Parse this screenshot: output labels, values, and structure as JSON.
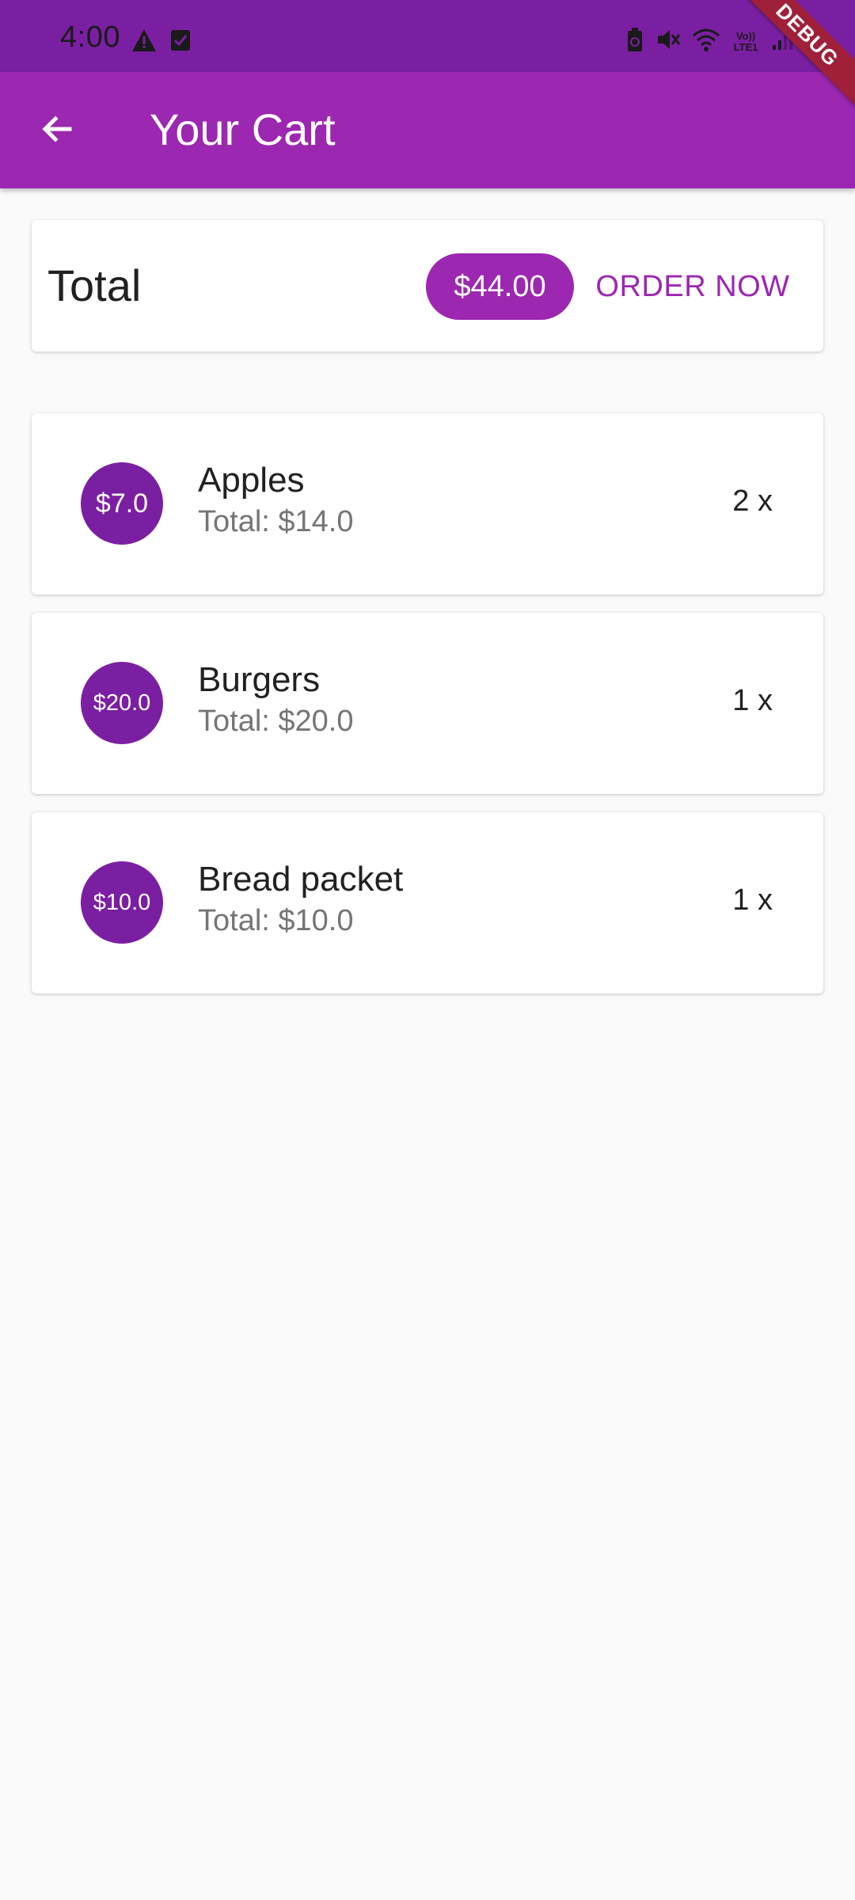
{
  "status_bar": {
    "time": "4:00",
    "icons": [
      "warning-icon",
      "checkbox-icon",
      "battery-saver-icon",
      "mute-icon",
      "wifi-icon",
      "volte-icon",
      "signal-icon",
      "battery-icon"
    ],
    "volte_label": "Vo)) LTE1"
  },
  "debug_banner": "DEBUG",
  "app_bar": {
    "back_icon": "arrow-back-icon",
    "title": "Your Cart"
  },
  "summary": {
    "label": "Total",
    "amount": "$44.00",
    "order_label": "ORDER NOW"
  },
  "items": [
    {
      "price": "$7.0",
      "name": "Apples",
      "subtotal": "Total: $14.0",
      "qty": "2 x"
    },
    {
      "price": "$20.0",
      "name": "Burgers",
      "subtotal": "Total: $20.0",
      "qty": "1 x"
    },
    {
      "price": "$10.0",
      "name": "Bread packet",
      "subtotal": "Total: $10.0",
      "qty": "1 x"
    }
  ],
  "colors": {
    "primary": "#9c27b0",
    "primary_dark": "#7b1fa2",
    "background": "#fafafa",
    "debug": "#a0203a"
  }
}
